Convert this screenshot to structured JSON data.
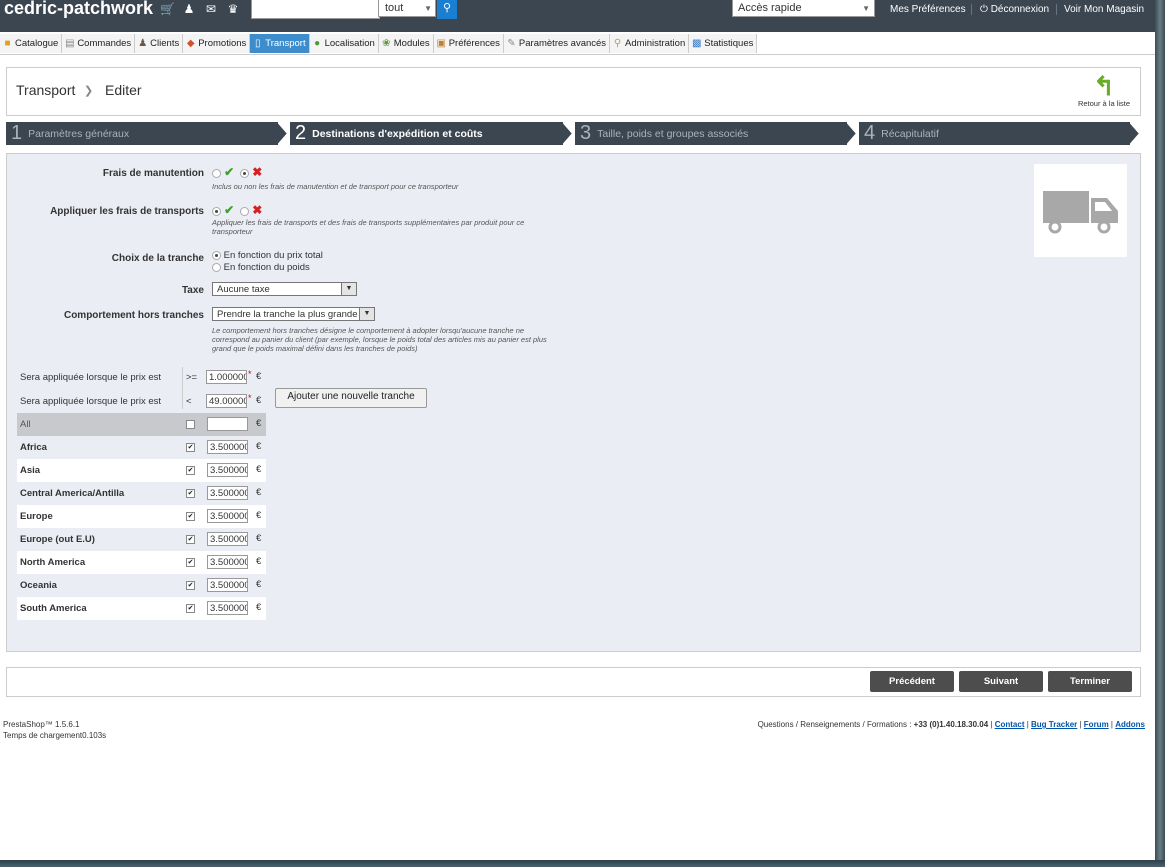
{
  "topbar": {
    "shop_name": "cedric-patchwork",
    "icons": [
      "cart-icon",
      "customers-icon",
      "messages-icon",
      "trophy-icon"
    ],
    "search_value": "",
    "search_scope": "tout",
    "quick_access": "Accès rapide",
    "links": {
      "preferences": "Mes Préférences",
      "logout": "Déconnexion",
      "view_shop": "Voir Mon Magasin"
    }
  },
  "tabs": [
    {
      "label": "Catalogue"
    },
    {
      "label": "Commandes"
    },
    {
      "label": "Clients"
    },
    {
      "label": "Promotions"
    },
    {
      "label": "Transport",
      "active": true
    },
    {
      "label": "Localisation"
    },
    {
      "label": "Modules"
    },
    {
      "label": "Préférences"
    },
    {
      "label": "Paramètres avancés"
    },
    {
      "label": "Administration"
    },
    {
      "label": "Statistiques"
    }
  ],
  "header": {
    "breadcrumb_section": "Transport",
    "breadcrumb_page": "Editer",
    "back_label": "Retour à la liste"
  },
  "steps": [
    {
      "number": "1",
      "label": "Paramètres généraux"
    },
    {
      "number": "2",
      "label": "Destinations d'expédition et coûts",
      "active": true
    },
    {
      "number": "3",
      "label": "Taille, poids et groupes associés"
    },
    {
      "number": "4",
      "label": "Récapitulatif"
    }
  ],
  "form": {
    "handling": {
      "label": "Frais de manutention",
      "value": "no",
      "help": "Inclus ou non les frais de manutention et de transport pour ce transporteur"
    },
    "shipping": {
      "label": "Appliquer les frais de transports",
      "value": "yes",
      "help_line1": "Appliquer les frais de transports et des frais de transports supplémentaires par produit pour ce",
      "help_line2": "transporteur"
    },
    "range": {
      "label": "Choix de la tranche",
      "option_price": "En fonction du prix total",
      "option_weight": "En fonction du poids",
      "selected": "price"
    },
    "tax": {
      "label": "Taxe",
      "value": "Aucune taxe"
    },
    "out_of_range": {
      "label": "Comportement hors tranches",
      "value": "Prendre la tranche la plus grande",
      "help_line1": "Le comportement hors tranches désigne le comportement à adopter lorsqu'aucune tranche ne",
      "help_line2": "correspond au panier du client (par exemple, lorsque le poids total des articles mis au panier est plus",
      "help_line3": "grand que le poids maximal défini dans les tranches de poids)"
    }
  },
  "ranges": {
    "row_label": "Sera appliquée lorsque le prix est",
    "min_operator": ">=",
    "min_value": "1.000000",
    "max_operator": "<",
    "max_value": "49.000000",
    "currency": "€",
    "add_button": "Ajouter une nouvelle tranche"
  },
  "zones": {
    "all_label": "All",
    "all_value": "",
    "items": [
      {
        "name": "Africa",
        "checked": true,
        "price": "3.500000"
      },
      {
        "name": "Asia",
        "checked": true,
        "price": "3.500000"
      },
      {
        "name": "Central America/Antilla",
        "checked": true,
        "price": "3.500000"
      },
      {
        "name": "Europe",
        "checked": true,
        "price": "3.500000"
      },
      {
        "name": "Europe (out E.U)",
        "checked": true,
        "price": "3.500000"
      },
      {
        "name": "North America",
        "checked": true,
        "price": "3.500000"
      },
      {
        "name": "Oceania",
        "checked": true,
        "price": "3.500000"
      },
      {
        "name": "South America",
        "checked": true,
        "price": "3.500000"
      }
    ]
  },
  "buttons": {
    "previous": "Précédent",
    "next": "Suivant",
    "finish": "Terminer"
  },
  "footer": {
    "version": "PrestaShop™ 1.5.6.1",
    "load_time": "Temps de chargement0.103s",
    "contact_text": "Questions / Renseignements / Formations :",
    "phone": "+33 (0)1.40.18.30.04",
    "links": [
      "Contact",
      "Bug Tracker",
      "Forum",
      "Addons"
    ]
  }
}
